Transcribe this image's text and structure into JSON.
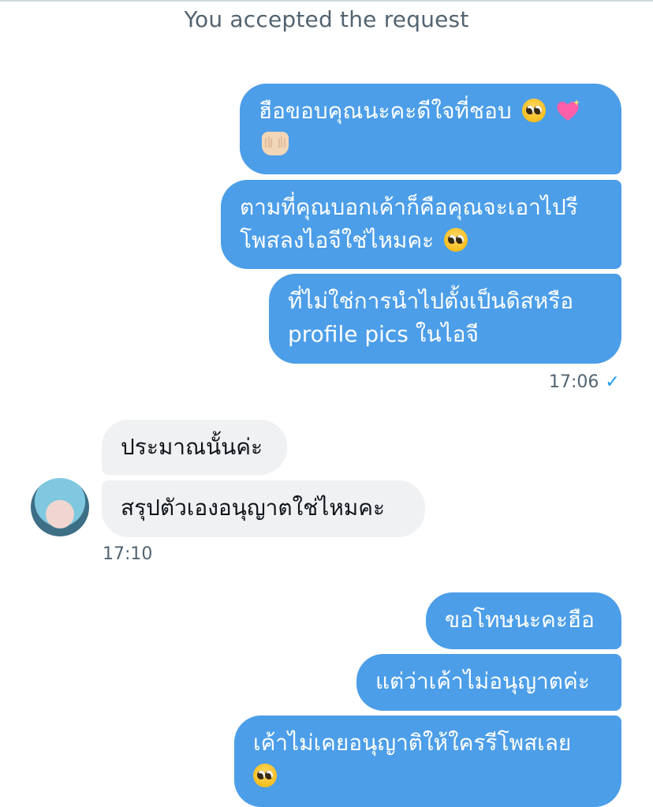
{
  "system_note": "You accepted the request",
  "messages_out_1": [
    {
      "lines": [
        "ฮือขอบคุณนะคะดีใจที่ชอบ"
      ],
      "emojis": [
        "pleading-face",
        "sparkling-heart",
        "palms-up-together"
      ]
    },
    {
      "lines": [
        "ตามที่คุณบอกเค้าก็คือคุณจะเอาไปรี",
        "โพสลงไอจีใช่ไหมคะ"
      ],
      "emojis": [
        "pleading-face"
      ]
    },
    {
      "lines": [
        "ที่ไม่ใช่การนำไปตั้งเป็นดิสหรือ",
        "profile pics ในไอจี"
      ]
    }
  ],
  "timestamp_out_1": "17:06",
  "messages_in": [
    {
      "text": "ประมาณนั้นค่ะ"
    },
    {
      "text": "สรุปตัวเองอนุญาตใช่ไหมคะ"
    }
  ],
  "timestamp_in": "17:10",
  "messages_out_2": [
    {
      "text": "ขอโทษนะคะฮือ"
    },
    {
      "text": "แต่ว่าเค้าไม่อนุญาตค่ะ"
    },
    {
      "text": "เค้าไม่เคยอนุญาติให้ใครรีโพสเลย",
      "emojis": [
        "pleading-face"
      ]
    }
  ],
  "colors": {
    "outgoing_bubble": "#4c9ee8",
    "incoming_bubble": "#eff1f3",
    "read_check": "#1d9bf0"
  },
  "icons": {
    "read_receipt": "checkmark-icon"
  }
}
